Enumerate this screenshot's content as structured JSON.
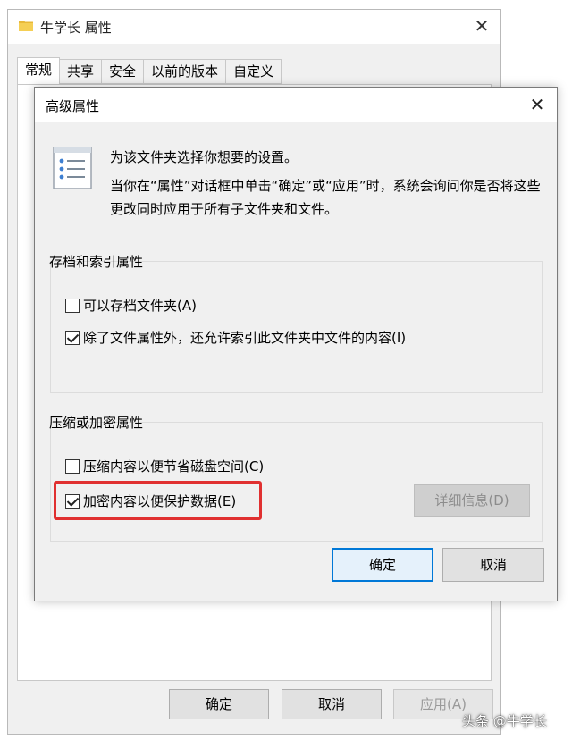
{
  "outer_window": {
    "title": "牛学长 属性",
    "tabs": [
      {
        "label": "常规",
        "active": true
      },
      {
        "label": "共享",
        "active": false
      },
      {
        "label": "安全",
        "active": false
      },
      {
        "label": "以前的版本",
        "active": false
      },
      {
        "label": "自定义",
        "active": false
      }
    ],
    "buttons": {
      "ok": "确定",
      "cancel": "取消",
      "apply": "应用(A)"
    }
  },
  "dialog": {
    "title": "高级属性",
    "intro_line1": "为该文件夹选择你想要的设置。",
    "intro_line2": "当你在“属性”对话框中单击“确定”或“应用”时，系统会询问你是否将这些更改同时应用于所有子文件夹和文件。",
    "archive_group": {
      "title": "存档和索引属性",
      "options": [
        {
          "label": "可以存档文件夹(A)",
          "checked": false
        },
        {
          "label": "除了文件属性外，还允许索引此文件夹中文件的内容(I)",
          "checked": true
        }
      ]
    },
    "compress_group": {
      "title": "压缩或加密属性",
      "options": [
        {
          "label": "压缩内容以便节省磁盘空间(C)",
          "checked": false
        },
        {
          "label": "加密内容以便保护数据(E)",
          "checked": true
        }
      ],
      "details_button": "详细信息(D)"
    },
    "ok_button": "确定",
    "cancel_button": "取消"
  },
  "colors": {
    "highlight_border": "#e03030",
    "default_button_border": "#0078d7"
  },
  "watermark": "头条 @牛学长"
}
